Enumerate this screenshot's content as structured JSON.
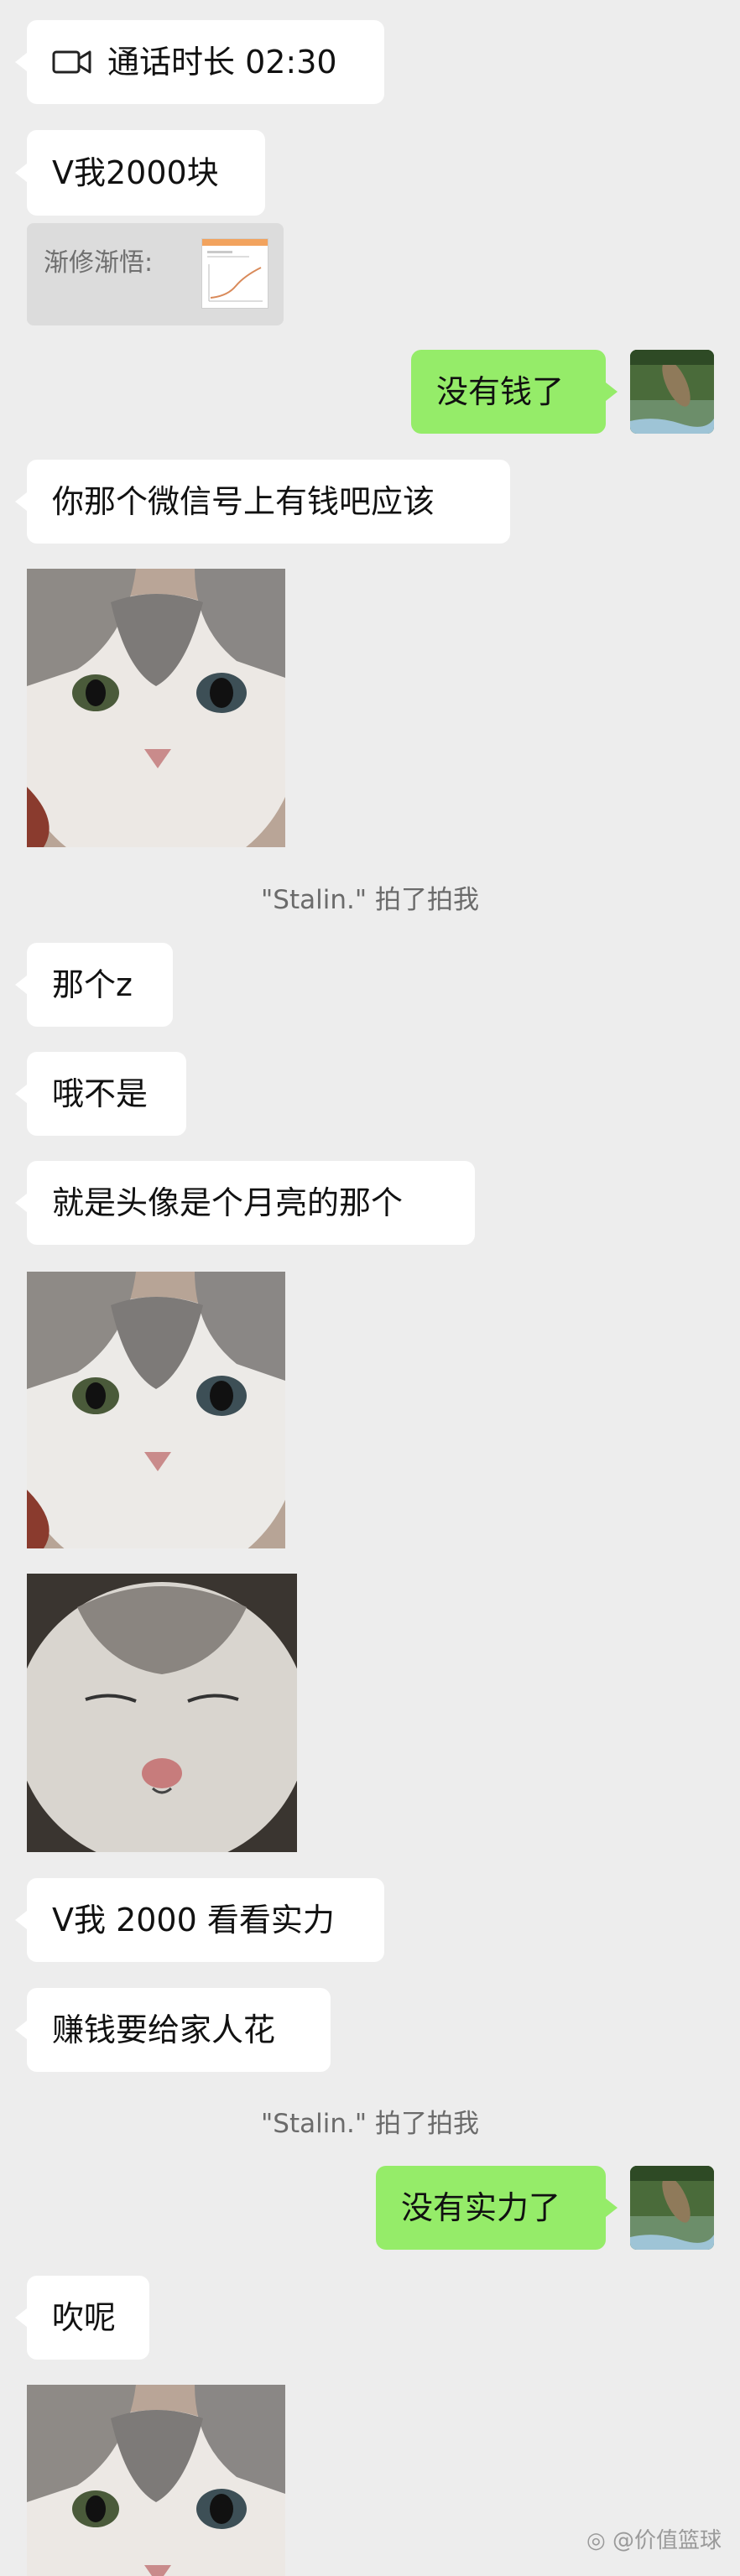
{
  "call": {
    "label": "通话时长 02:30",
    "icon": "video-call-icon"
  },
  "colors": {
    "background": "#ededed",
    "incoming_bubble": "#ffffff",
    "outgoing_bubble": "#95ec69",
    "system_text": "#6b6b6b"
  },
  "messages": {
    "m1": "V我2000块",
    "quote": "渐修渐悟:",
    "m2": "没有钱了",
    "m3": "你那个微信号上有钱吧应该",
    "m4": "那个z",
    "m5": "哦不是",
    "m6": "就是头像是个月亮的那个",
    "m7": "V我 2000 看看实力",
    "m8": "赚钱要给家人花",
    "m9": "没有实力了",
    "m10": "吹呢"
  },
  "system": {
    "pat1": "\"Stalin.\" 拍了拍我",
    "pat2": "\"Stalin.\" 拍了拍我"
  },
  "watermark": "@价值篮球"
}
